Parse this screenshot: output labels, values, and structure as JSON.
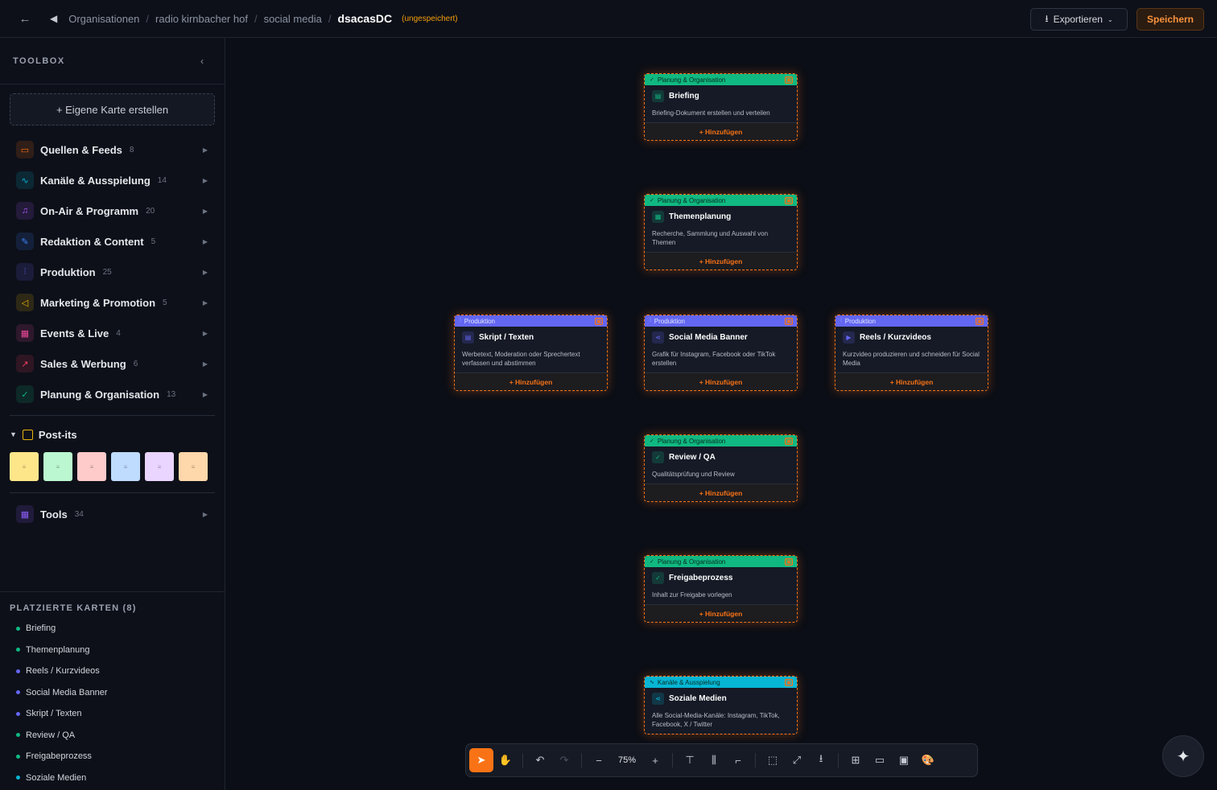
{
  "header": {
    "crumbs": [
      "Organisationen",
      "radio kirnbacher hof",
      "social media"
    ],
    "current": "dsacasDC",
    "unsaved_label": "(ungespeichert)",
    "export_label": "Exportieren",
    "save_label": "Speichern"
  },
  "sidebar": {
    "title": "TOOLBOX",
    "create_label": "+ Eigene Karte erstellen",
    "categories": [
      {
        "name": "Quellen & Feeds",
        "count": "8",
        "color": "#f97316"
      },
      {
        "name": "Kanäle & Ausspielung",
        "count": "14",
        "color": "#06b6d4"
      },
      {
        "name": "On-Air & Programm",
        "count": "20",
        "color": "#a855f7"
      },
      {
        "name": "Redaktion & Content",
        "count": "5",
        "color": "#3b82f6"
      },
      {
        "name": "Produktion",
        "count": "25",
        "color": "#6366f1"
      },
      {
        "name": "Marketing & Promotion",
        "count": "5",
        "color": "#eab308"
      },
      {
        "name": "Events & Live",
        "count": "4",
        "color": "#ec4899"
      },
      {
        "name": "Sales & Werbung",
        "count": "6",
        "color": "#f43f5e"
      },
      {
        "name": "Planung & Organisation",
        "count": "13",
        "color": "#10b981"
      }
    ],
    "postits_label": "Post-its",
    "postit_colors": [
      "#fde68a",
      "#bbf7d0",
      "#fecaca",
      "#bfdbfe",
      "#e9d5ff",
      "#fed7aa"
    ],
    "tools": {
      "name": "Tools",
      "count": "34",
      "color": "#8b5cf6"
    }
  },
  "placed": {
    "title": "PLATZIERTE KARTEN (8)",
    "items": [
      {
        "label": "Briefing",
        "color": "#10b981"
      },
      {
        "label": "Themenplanung",
        "color": "#10b981"
      },
      {
        "label": "Reels / Kurzvideos",
        "color": "#6366f1"
      },
      {
        "label": "Social Media Banner",
        "color": "#6366f1"
      },
      {
        "label": "Skript / Texten",
        "color": "#6366f1"
      },
      {
        "label": "Review / QA",
        "color": "#10b981"
      },
      {
        "label": "Freigabeprozess",
        "color": "#10b981"
      },
      {
        "label": "Soziale Medien",
        "color": "#06b6d4"
      }
    ]
  },
  "nodes": [
    {
      "id": "briefing",
      "category": "Planung & Organisation",
      "title": "Briefing",
      "desc": "Briefing-Dokument erstellen und verteilen",
      "add": "+ Hinzufügen",
      "head_color": "#10b981",
      "icon": "document-icon"
    },
    {
      "id": "themenplanung",
      "category": "Planung & Organisation",
      "title": "Themenplanung",
      "desc": "Recherche, Sammlung und Auswahl von Themen",
      "add": "+ Hinzufügen",
      "head_color": "#10b981",
      "icon": "calendar-icon"
    },
    {
      "id": "skript",
      "category": "Produktion",
      "title": "Skript / Texten",
      "desc": "Werbetext, Moderation oder Sprechertext verfassen und abstimmen",
      "add": "+ Hinzufügen",
      "head_color": "#6366f1",
      "icon": "document-icon"
    },
    {
      "id": "banner",
      "category": "Produktion",
      "title": "Social Media Banner",
      "desc": "Grafik für Instagram, Facebook oder TikTok erstellen",
      "add": "+ Hinzufügen",
      "head_color": "#6366f1",
      "icon": "share-icon"
    },
    {
      "id": "reels",
      "category": "Produktion",
      "title": "Reels / Kurzvideos",
      "desc": "Kurzvideo produzieren und schneiden für Social Media",
      "add": "+ Hinzufügen",
      "head_color": "#6366f1",
      "icon": "video-icon"
    },
    {
      "id": "review",
      "category": "Planung & Organisation",
      "title": "Review / QA",
      "desc": "Qualitätsprüfung und Review",
      "add": "+ Hinzufügen",
      "head_color": "#10b981",
      "icon": "check-circle-icon"
    },
    {
      "id": "freigabe",
      "category": "Planung & Organisation",
      "title": "Freigabeprozess",
      "desc": "Inhalt zur Freigabe vorlegen",
      "add": "+ Hinzufügen",
      "head_color": "#10b981",
      "icon": "check-circle-icon"
    },
    {
      "id": "soziale",
      "category": "Kanäle & Ausspielung",
      "title": "Soziale Medien",
      "desc": "Alle Social-Media-Kanäle: Instagram, TikTok, Facebook, X / Twitter",
      "add": "",
      "head_color": "#06b6d4",
      "icon": "share-icon"
    }
  ],
  "toolbar": {
    "zoom": "75%"
  }
}
